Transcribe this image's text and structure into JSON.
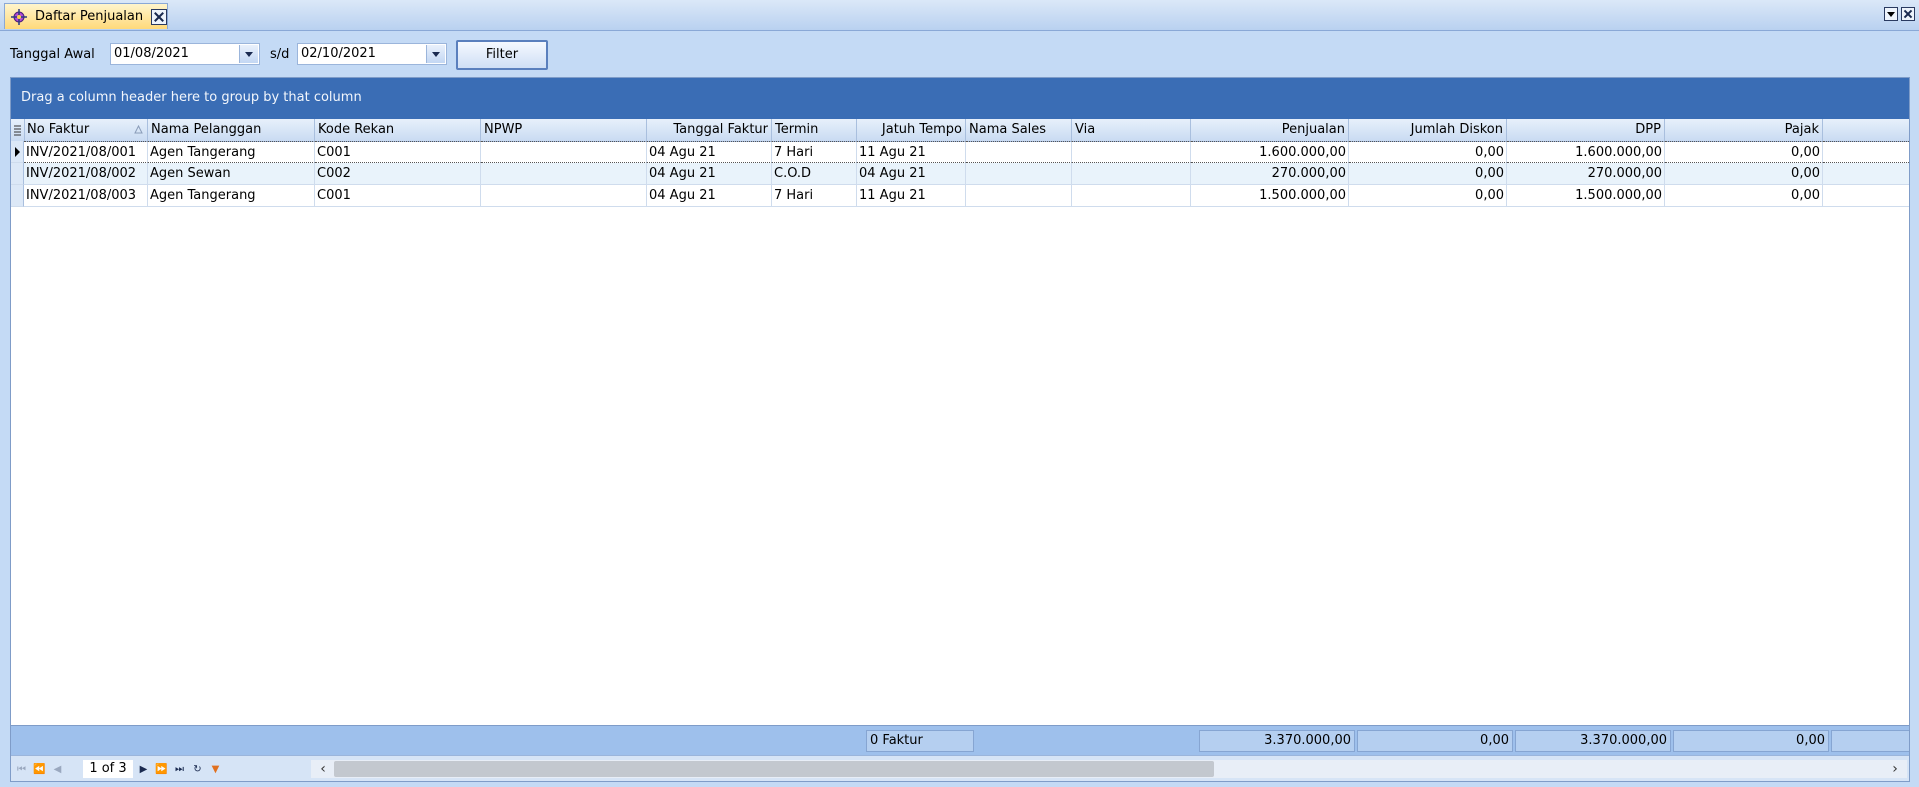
{
  "window": {
    "tab_title": "Daftar Penjualan"
  },
  "filter": {
    "start_label": "Tanggal Awal",
    "start_value": "01/08/2021",
    "range_sep": "s/d",
    "end_value": "02/10/2021",
    "button_label": "Filter"
  },
  "grid": {
    "group_hint": "Drag a column header here to group by that column",
    "columns": [
      "No Faktur",
      "Nama Pelanggan",
      "Kode Rekan",
      "NPWP",
      "Tanggal Faktur",
      "Termin",
      "Jatuh Tempo",
      "Nama Sales",
      "Via",
      "Penjualan",
      "Jumlah Diskon",
      "DPP",
      "Pajak"
    ],
    "rows": [
      [
        "INV/2021/08/001",
        "Agen Tangerang",
        "C001",
        "",
        "04 Agu 21",
        "7 Hari",
        "11 Agu 21",
        "",
        "",
        "1.600.000,00",
        "0,00",
        "1.600.000,00",
        "0,00"
      ],
      [
        "INV/2021/08/002",
        "Agen Sewan",
        "C002",
        "",
        "04 Agu 21",
        "C.O.D",
        "04 Agu 21",
        "",
        "",
        "270.000,00",
        "0,00",
        "270.000,00",
        "0,00"
      ],
      [
        "INV/2021/08/003",
        "Agen Tangerang",
        "C001",
        "",
        "04 Agu 21",
        "7 Hari",
        "11 Agu 21",
        "",
        "",
        "1.500.000,00",
        "0,00",
        "1.500.000,00",
        "0,00"
      ]
    ],
    "footer": {
      "count": "0 Faktur",
      "penjualan": "3.370.000,00",
      "diskon": "0,00",
      "dpp": "3.370.000,00",
      "pajak": "0,00"
    },
    "pager": "1 of 3"
  },
  "colors": {
    "group_panel": "#3a6db5",
    "background": "#c4daf5",
    "footer": "#9ec0ec"
  }
}
